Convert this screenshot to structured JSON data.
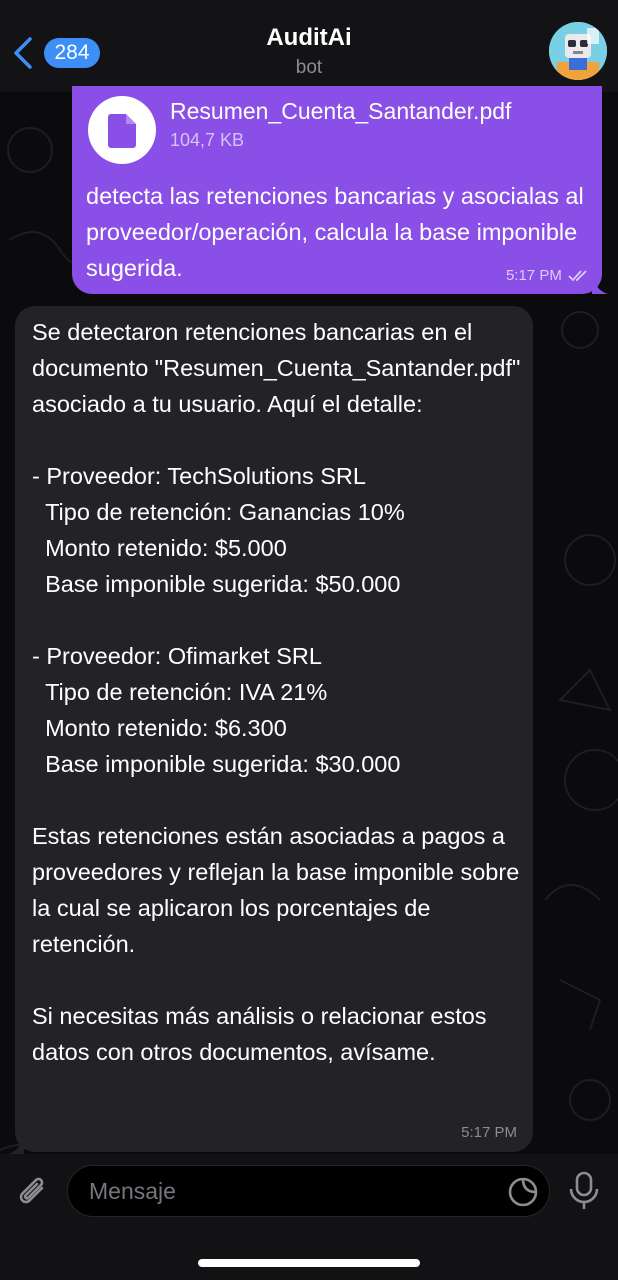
{
  "header": {
    "back_count": "284",
    "title": "AuditAi",
    "subtitle": "bot"
  },
  "outgoing": {
    "file_name": "Resumen_Cuenta_Santander.pdf",
    "file_size": "104,7 KB",
    "text": "detecta las retenciones bancarias y asocialas al proveedor/operación, calcula la base imponible sugerida.",
    "time": "5:17 PM"
  },
  "incoming": {
    "text": "Se detectaron retenciones bancarias en el documento \"Resumen_Cuenta_Santander.pdf\" asociado a tu usuario. Aquí el detalle:\n\n- Proveedor: TechSolutions SRL\n  Tipo de retención: Ganancias 10%\n  Monto retenido: $5.000\n  Base imponible sugerida: $50.000\n\n- Proveedor: Ofimarket SRL\n  Tipo de retención: IVA 21%\n  Monto retenido: $6.300\n  Base imponible sugerida: $30.000\n\nEstas retenciones están asociadas a pagos a proveedores y reflejan la base imponible sobre la cual se aplicaron los porcentajes de retención.\n\nSi necesitas más análisis o relacionar estos datos con otros documentos, avísame.",
    "time": "5:17 PM"
  },
  "input": {
    "placeholder": "Mensaje"
  },
  "icons": [
    "back-chevron-icon",
    "avatar",
    "file-icon",
    "double-check-icon",
    "attach-icon",
    "sticker-icon",
    "mic-icon"
  ],
  "colors": {
    "accent": "#3e8ef7",
    "outgoing_bubble": "#8a4fe6",
    "incoming_bubble": "#232227"
  }
}
